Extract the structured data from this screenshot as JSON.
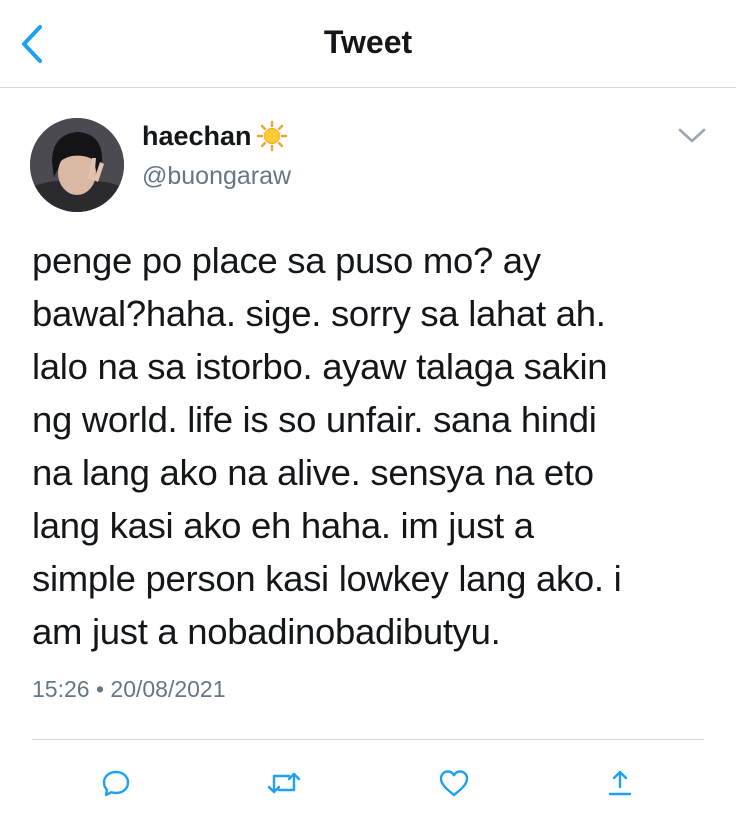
{
  "header": {
    "title": "Tweet",
    "back_icon": "chevron-left-icon"
  },
  "tweet": {
    "author": {
      "display_name": "haechan",
      "name_emoji": "sun-icon",
      "handle": "@buongaraw"
    },
    "text": "penge po place sa puso mo? ay\nbawal?haha. sige. sorry sa lahat ah.\nlalo na sa istorbo. ayaw talaga sakin\nng world. life is so unfair. sana hindi\nna lang ako na alive. sensya na eto\nlang kasi ako eh haha. im just a\nsimple person kasi lowkey lang ako. i\nam just a nobadinobadibutyu.",
    "time": "15:26",
    "separator": "•",
    "date": "20/08/2021",
    "actions": [
      "reply-icon",
      "retweet-icon",
      "like-icon",
      "share-icon"
    ]
  },
  "colors": {
    "accent": "#1da1f2",
    "text": "#14171a",
    "secondary": "#657786",
    "divider": "#d6d9dc"
  }
}
